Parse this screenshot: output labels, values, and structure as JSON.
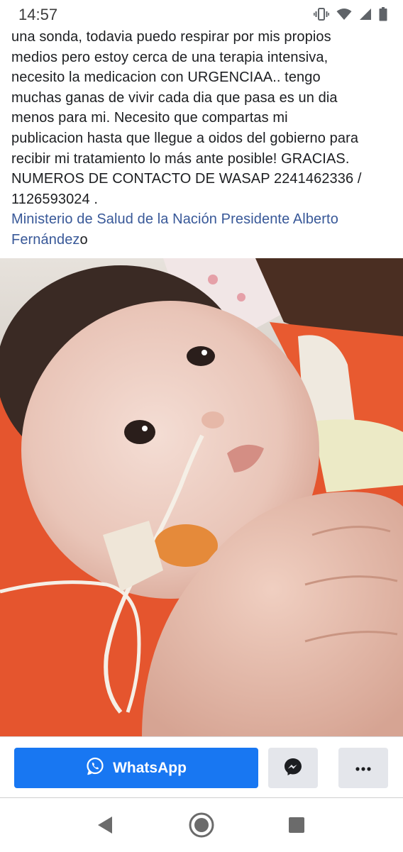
{
  "status_bar": {
    "time": "14:57",
    "icons": [
      "vibrate-icon",
      "wifi-icon",
      "signal-icon",
      "battery-icon"
    ]
  },
  "post": {
    "lines": [
      "una sonda, todavia puedo respirar por mis propios",
      "medios pero estoy cerca de una terapia intensiva,",
      "necesito la medicacion con URGENCIAA.. tengo",
      "muchas ganas de vivir cada dia que pasa es un dia",
      "menos para mi. Necesito que compartas mi",
      "publicacion hasta que llegue a oidos del gobierno para",
      "recibir mi tratamiento lo más ante posible! GRACIAS.",
      "NUMEROS DE CONTACTO DE WASAP 2241462336 /",
      "1126593024 ."
    ],
    "mention_line1": "Ministerio de Salud de la Nación Presidente Alberto",
    "mention_line2": "Fernández",
    "mention_suffix": "o",
    "link_color": "#385898"
  },
  "photo": {
    "icon": "photo-icon"
  },
  "actions": {
    "whatsapp_label": "WhatsApp",
    "whatsapp_color": "#1877f2",
    "messenger_icon": "messenger-icon",
    "more_icon": "more-icon"
  },
  "nav": {
    "back_icon": "back-icon",
    "home_icon": "home-icon",
    "recent_icon": "recent-apps-icon"
  }
}
